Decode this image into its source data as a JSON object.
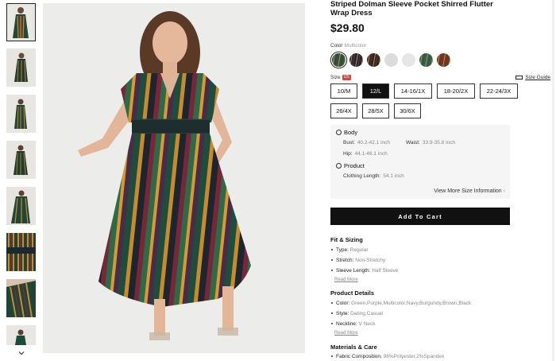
{
  "product": {
    "title": "Striped Dolman Sleeve Pocket Shirred Flutter Wrap Dress",
    "price": "$29.80"
  },
  "color": {
    "label": "Color",
    "selected": "Multicolor",
    "swatches": [
      {
        "name": "multicolor-stripe",
        "hex": "#1f5a44"
      },
      {
        "name": "navy-stripe",
        "hex": "#1c2a3c"
      },
      {
        "name": "black-stripe",
        "hex": "#2a2a2a"
      },
      {
        "name": "white-pattern",
        "hex": "#dcdcdc"
      },
      {
        "name": "white-floral",
        "hex": "#e6e6e6"
      },
      {
        "name": "green-pattern",
        "hex": "#1f6b55"
      },
      {
        "name": "brown-pattern",
        "hex": "#6a3a26"
      }
    ]
  },
  "size": {
    "label": "Size",
    "badge": "US",
    "guide": "Size Guide",
    "options": [
      "10/M",
      "12/L",
      "14-16/1X",
      "18-20/2X",
      "22-24/3X",
      "26/4X",
      "28/5X",
      "30/6X"
    ],
    "selected": "12/L"
  },
  "measurements": {
    "body_title": "Body",
    "bust_label": "Bust:",
    "bust_value": "40.2-42.1 inch",
    "waist_label": "Waist:",
    "waist_value": "33.9-35.8 inch",
    "hip_label": "Hip:",
    "hip_value": "44.1-46.1 inch",
    "product_title": "Product",
    "clothing_length_label": "Clothing Length:",
    "clothing_length_value": "54.1 inch",
    "more": "View More Size Information"
  },
  "cart": {
    "label": "Add To Cart"
  },
  "fit": {
    "title": "Fit & Sizing",
    "type_label": "Type:",
    "type_value": "Regular",
    "stretch_label": "Stretch:",
    "stretch_value": "Non-Stretchy",
    "sleeve_label": "Sleeve Length:",
    "sleeve_value": "Half Sleeve",
    "read_more": "Read More"
  },
  "details": {
    "title": "Product Details",
    "color_label": "Color:",
    "color_value": "Green,Purple,Multicolor,Navy,Burgundy,Brown,Black",
    "style_label": "Style:",
    "style_value": "Dating,Casual",
    "neckline_label": "Neckline:",
    "neckline_value": "V Neck",
    "read_more": "Read More"
  },
  "materials": {
    "title": "Materials & Care",
    "fabric_label": "Fabric Composition:",
    "fabric_value": "98%Polyester,2%Spandex"
  }
}
